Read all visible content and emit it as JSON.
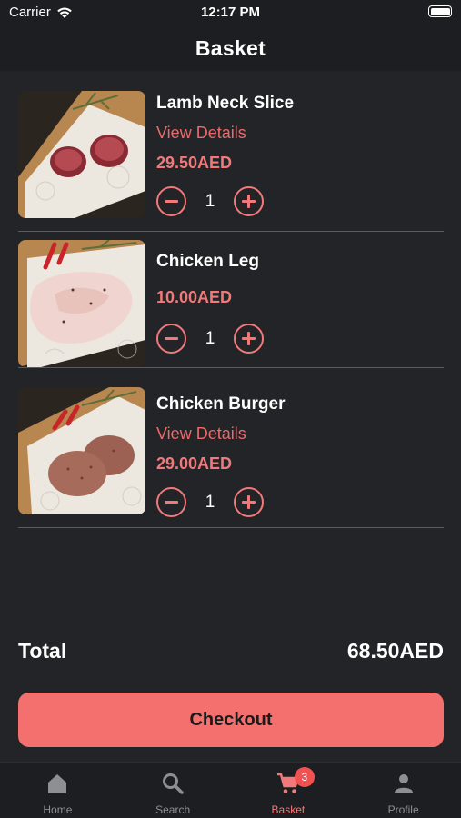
{
  "status_bar": {
    "carrier": "Carrier",
    "time": "12:17 PM"
  },
  "header": {
    "title": "Basket"
  },
  "items": [
    {
      "name": "Lamb Neck Slice",
      "details_link": "View Details",
      "price": "29.50AED",
      "quantity": "1",
      "image": "lamb-neck-photo"
    },
    {
      "name": "Chicken Leg",
      "price": "10.00AED",
      "quantity": "1",
      "image": "chicken-leg-photo"
    },
    {
      "name": "Chicken Burger",
      "details_link": "View Details",
      "price": "29.00AED",
      "quantity": "1",
      "image": "chicken-burger-photo"
    }
  ],
  "total": {
    "label": "Total",
    "value": "68.50AED"
  },
  "checkout": {
    "label": "Checkout"
  },
  "tab_bar": {
    "tabs": [
      {
        "label": "Home",
        "icon": "home-icon"
      },
      {
        "label": "Search",
        "icon": "search-icon"
      },
      {
        "label": "Basket",
        "icon": "cart-icon",
        "badge": "3",
        "active": true
      },
      {
        "label": "Profile",
        "icon": "person-icon"
      }
    ]
  },
  "colors": {
    "accent": "#f3706f",
    "background": "#232427",
    "bar": "#1d1e21"
  }
}
